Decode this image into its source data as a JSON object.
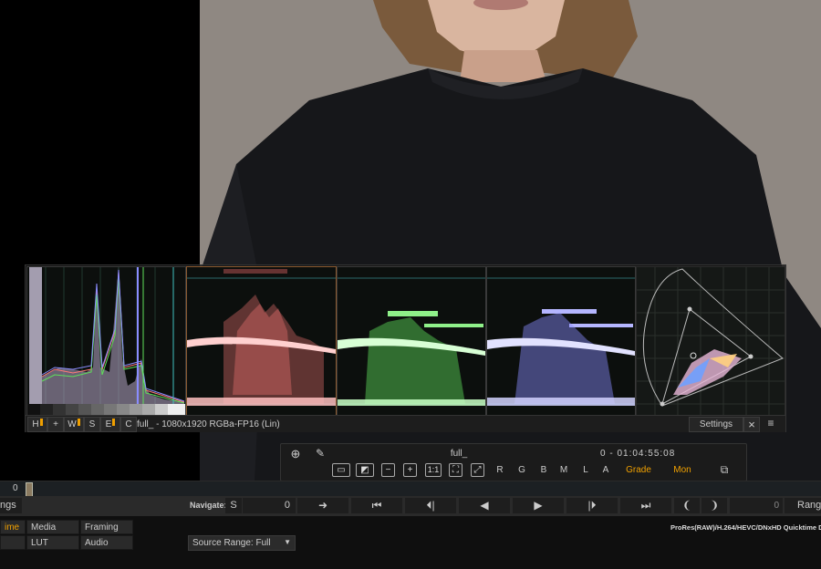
{
  "scopes": {
    "hist_buttons": [
      {
        "label": "H",
        "mark": true
      },
      {
        "label": "+",
        "mark": false
      },
      {
        "label": "W",
        "mark": true
      },
      {
        "label": "S",
        "mark": false
      },
      {
        "label": "E",
        "mark": true
      },
      {
        "label": "C",
        "mark": false
      }
    ],
    "info": "full_ - 1080x1920 RGBa-FP16 (Lin)",
    "settings_label": "Settings",
    "close_icon": "×",
    "menu_icon": "≡",
    "colors": {
      "red": "#ff7a78",
      "green": "#5fe05a",
      "blue": "#8a8cff",
      "accent": "#f0a000"
    }
  },
  "viewer_toolbar": {
    "clip_name": "full_",
    "timecode": "0  -  01:04:55:08",
    "channel_buttons": [
      "R",
      "G",
      "B",
      "M",
      "L",
      "A"
    ],
    "grade_label": "Grade",
    "mon_label": "Mon",
    "zoom_one": "1:1"
  },
  "timeline": {
    "frame": "0"
  },
  "navigate": {
    "settings_cut": "ngs",
    "label": "Navigate:",
    "s_label": "S",
    "frame_value": "0",
    "right_value": "0",
    "range_cut": "Range"
  },
  "bottom": {
    "tabs_row1": [
      "ime",
      "Media",
      "Framing"
    ],
    "tabs_row2": [
      "",
      "LUT",
      "Audio"
    ],
    "source_range": "Source Range: Full",
    "codec_info": "ProRes(RAW)/H.264/HEVC/DNxHD Quicktime Deco"
  }
}
